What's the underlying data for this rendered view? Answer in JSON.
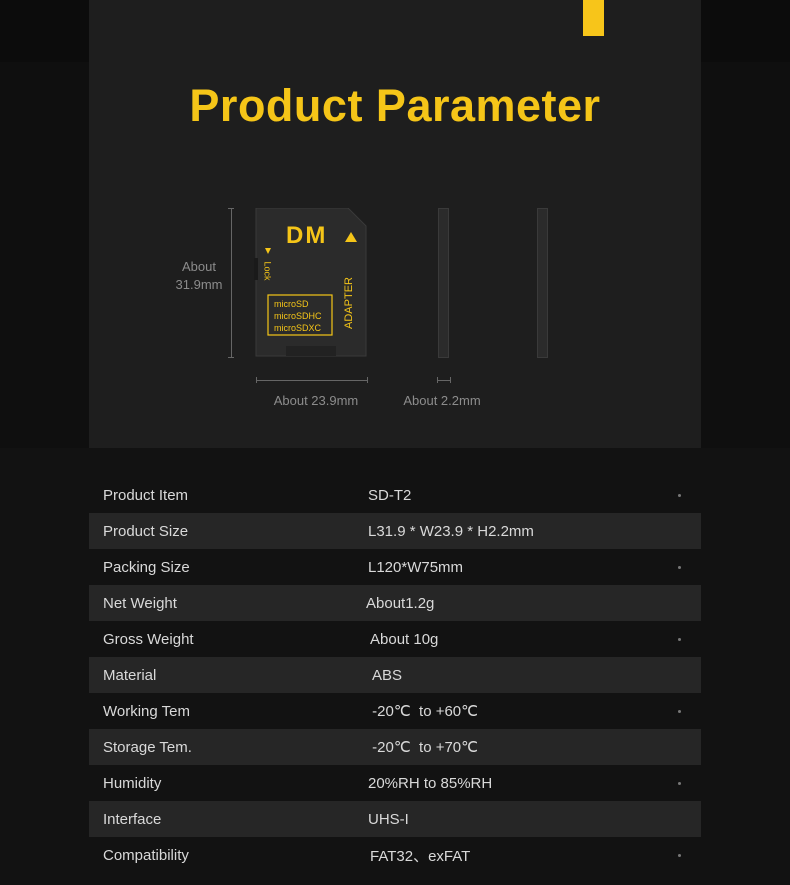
{
  "header": {
    "title": "Product Parameter"
  },
  "card": {
    "brand": "DM",
    "lock_label": "Lock",
    "formats": [
      "microSD",
      "microSDHC",
      "microSDXC"
    ],
    "adapter_label": "ADAPTER"
  },
  "dimensions": {
    "height_line1": "About",
    "height_line2": "31.9mm",
    "width": "About 23.9mm",
    "thickness": "About 2.2mm"
  },
  "specs": [
    {
      "label": "Product Item",
      "value": "SD-T2"
    },
    {
      "label": "Product Size",
      "value": "L31.9 * W23.9 * H2.2mm"
    },
    {
      "label": "Packing Size",
      "value": "L120*W75mm"
    },
    {
      "label": "Net Weight",
      "value": "About1.2g"
    },
    {
      "label": "Gross Weight",
      "value": "About 10g"
    },
    {
      "label": "Material",
      "value": "ABS"
    },
    {
      "label": "Working Tem",
      "value": " -20℃  to +60℃"
    },
    {
      "label": "Storage Tem.",
      "value": " -20℃  to +70℃"
    },
    {
      "label": "Humidity",
      "value": "20%RH to 85%RH"
    },
    {
      "label": "Interface",
      "value": "UHS-I"
    },
    {
      "label": "Compatibility",
      "value": "FAT32、exFAT"
    }
  ],
  "colors": {
    "accent": "#f5c518",
    "background": "#121212",
    "panel": "#1e1e1e",
    "row_alt": "#262626"
  }
}
